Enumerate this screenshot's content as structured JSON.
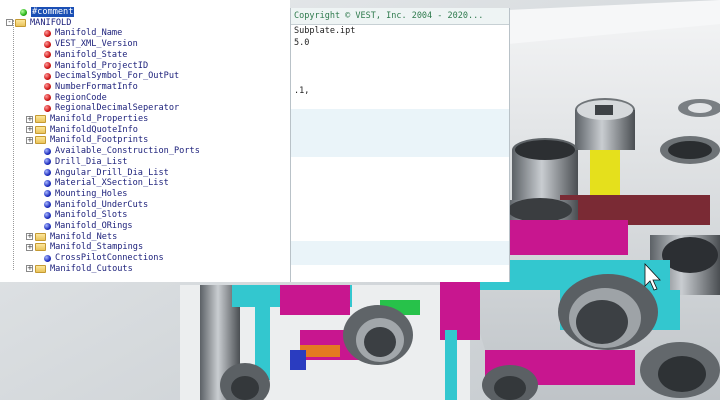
{
  "tree": {
    "items": [
      {
        "label": "#comment",
        "icon": "green-dot-icon",
        "level": 1,
        "expander": "",
        "selected": true
      },
      {
        "label": "MANIFOLD",
        "icon": "folder-icon",
        "level": 0,
        "expander": "-",
        "selected": false
      },
      {
        "label": "Manifold_Name",
        "icon": "red-dot-icon",
        "level": 2,
        "expander": ""
      },
      {
        "label": "VEST_XML_Version",
        "icon": "red-dot-icon",
        "level": 2,
        "expander": ""
      },
      {
        "label": "Manifold_State",
        "icon": "red-dot-icon",
        "level": 2,
        "expander": ""
      },
      {
        "label": "Manifold_ProjectID",
        "icon": "red-dot-icon",
        "level": 2,
        "expander": ""
      },
      {
        "label": "DecimalSymbol_For_OutPut",
        "icon": "red-dot-icon",
        "level": 2,
        "expander": ""
      },
      {
        "label": "NumberFormatInfo",
        "icon": "red-dot-icon",
        "level": 2,
        "expander": ""
      },
      {
        "label": "RegionCode",
        "icon": "red-dot-icon",
        "level": 2,
        "expander": ""
      },
      {
        "label": "RegionalDecimalSeperator",
        "icon": "red-dot-icon",
        "level": 2,
        "expander": ""
      },
      {
        "label": "Manifold_Properties",
        "icon": "folder-icon",
        "level": 1,
        "expander": "+"
      },
      {
        "label": "ManifoldQuoteInfo",
        "icon": "folder-icon",
        "level": 1,
        "expander": "+"
      },
      {
        "label": "Manifold_Footprints",
        "icon": "folder-icon",
        "level": 1,
        "expander": "+"
      },
      {
        "label": "Available_Construction_Ports",
        "icon": "blue-dot-icon",
        "level": 2,
        "expander": ""
      },
      {
        "label": "Drill_Dia_List",
        "icon": "blue-dot-icon",
        "level": 2,
        "expander": ""
      },
      {
        "label": "Angular_Drill_Dia_List",
        "icon": "blue-dot-icon",
        "level": 2,
        "expander": ""
      },
      {
        "label": "Material_XSection_List",
        "icon": "blue-dot-icon",
        "level": 2,
        "expander": ""
      },
      {
        "label": "Mounting_Holes",
        "icon": "blue-dot-icon",
        "level": 2,
        "expander": ""
      },
      {
        "label": "Manifold_UnderCuts",
        "icon": "blue-dot-icon",
        "level": 2,
        "expander": ""
      },
      {
        "label": "Manifold_Slots",
        "icon": "blue-dot-icon",
        "level": 2,
        "expander": ""
      },
      {
        "label": "Manifold_ORings",
        "icon": "blue-dot-icon",
        "level": 2,
        "expander": ""
      },
      {
        "label": "Manifold_Nets",
        "icon": "folder-icon",
        "level": 1,
        "expander": "+"
      },
      {
        "label": "Manifold_Stampings",
        "icon": "folder-icon",
        "level": 1,
        "expander": "+"
      },
      {
        "label": "CrossPilotConnections",
        "icon": "blue-dot-icon",
        "level": 2,
        "expander": ""
      },
      {
        "label": "Manifold_Cutouts",
        "icon": "folder-icon",
        "level": 1,
        "expander": "+"
      }
    ]
  },
  "editor": {
    "header": "Copyright © VEST, Inc.  2004 - 2020...",
    "rows": [
      "Subplate.ipt",
      "5.0",
      "",
      "",
      "",
      ".1,",
      "",
      "",
      "",
      "",
      "",
      "",
      "",
      "",
      "",
      "",
      "",
      "",
      "",
      "",
      "",
      ""
    ]
  },
  "viewport": {
    "colors": {
      "pink": "#c8168f",
      "cyan": "#33c7cf",
      "yellow": "#e5e01c",
      "steel": "#9aa0a6",
      "maroon": "#7a2a34",
      "orange": "#e47a22",
      "blue": "#2a3cc0",
      "green": "#27c24a"
    }
  }
}
